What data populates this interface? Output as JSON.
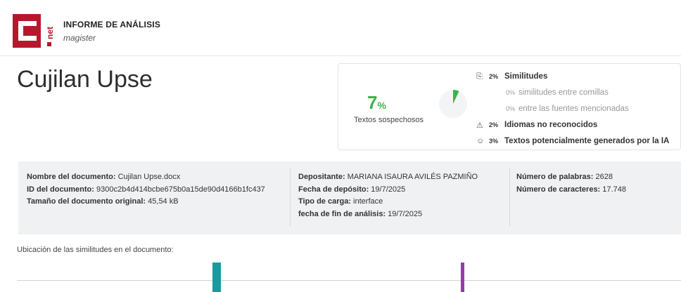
{
  "header": {
    "logo_letters": "C.net",
    "title": "INFORME DE ANÁLISIS",
    "subtitle": "magister"
  },
  "document": {
    "title": "Cujilan Upse"
  },
  "score": {
    "percent": "7",
    "percent_unit": "%",
    "label": "Textos sospechosos",
    "accent_color": "#3bb34a",
    "metrics": [
      {
        "icon": "copy-icon",
        "value": "2%",
        "label": "Similitudes",
        "level": "main"
      },
      {
        "icon": "",
        "value": "0%",
        "label": "similitudes entre comillas",
        "level": "sub"
      },
      {
        "icon": "",
        "value": "0%",
        "label": "entre las fuentes mencionadas",
        "level": "sub"
      },
      {
        "icon": "language-warning-icon",
        "value": "2%",
        "label": "Idiomas no reconocidos",
        "level": "main"
      },
      {
        "icon": "ai-robot-icon",
        "value": "3%",
        "label": "Textos potencialmente generados por la IA",
        "level": "main"
      }
    ]
  },
  "info": {
    "col1": [
      {
        "label": "Nombre del documento:",
        "value": "Cujilan Upse.docx"
      },
      {
        "label": "ID del documento:",
        "value": "9300c2b4d414bcbe675b0a15de90d4166b1fc437"
      },
      {
        "label": "Tamaño del documento original:",
        "value": "45,54 kB"
      }
    ],
    "col2": [
      {
        "label": "Depositante:",
        "value": "MARIANA ISAURA AVILÉS PAZMIÑO"
      },
      {
        "label": "Fecha de depósito:",
        "value": "19/7/2025"
      },
      {
        "label": "Tipo de carga:",
        "value": "interface"
      },
      {
        "label": "fecha de fin de análisis:",
        "value": "19/7/2025"
      }
    ],
    "col3": [
      {
        "label": "Número de palabras:",
        "value": "2628"
      },
      {
        "label": "Número de caracteres:",
        "value": "17.748"
      }
    ]
  },
  "location": {
    "label": "Ubicación de las similitudes en el documento:",
    "markers": [
      {
        "position_pct": 29.5,
        "color": "#1a9aa0"
      },
      {
        "position_pct": 66.8,
        "color": "#8e3fa3"
      }
    ]
  }
}
